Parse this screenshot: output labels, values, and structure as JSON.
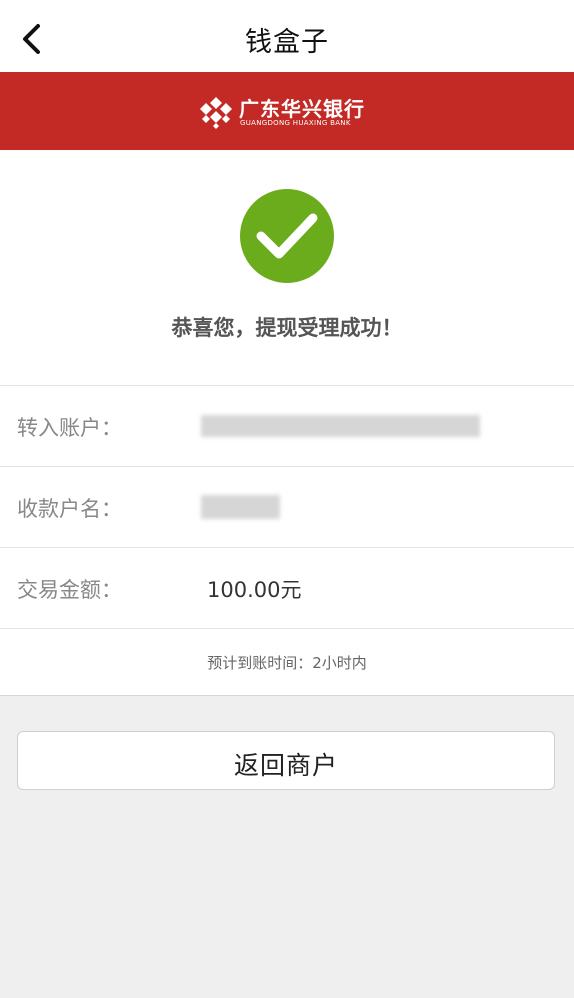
{
  "header": {
    "title": "钱盒子",
    "back_icon": "chevron-left-icon"
  },
  "bank": {
    "name_cn": "广东华兴银行",
    "name_en": "GUANGDONG HUAXING BANK",
    "brand_color": "#c32a26"
  },
  "result": {
    "status_icon": "check-circle-icon",
    "status_color": "#6aac1c",
    "message": "恭喜您，提现受理成功！"
  },
  "details": [
    {
      "label": "转入账户：",
      "value": ""
    },
    {
      "label": "收款户名：",
      "value": ""
    },
    {
      "label": "交易金额：",
      "value": "100.00元"
    }
  ],
  "arrival_note": "预计到账时间：2小时内",
  "actions": {
    "return_label": "返回商户"
  }
}
